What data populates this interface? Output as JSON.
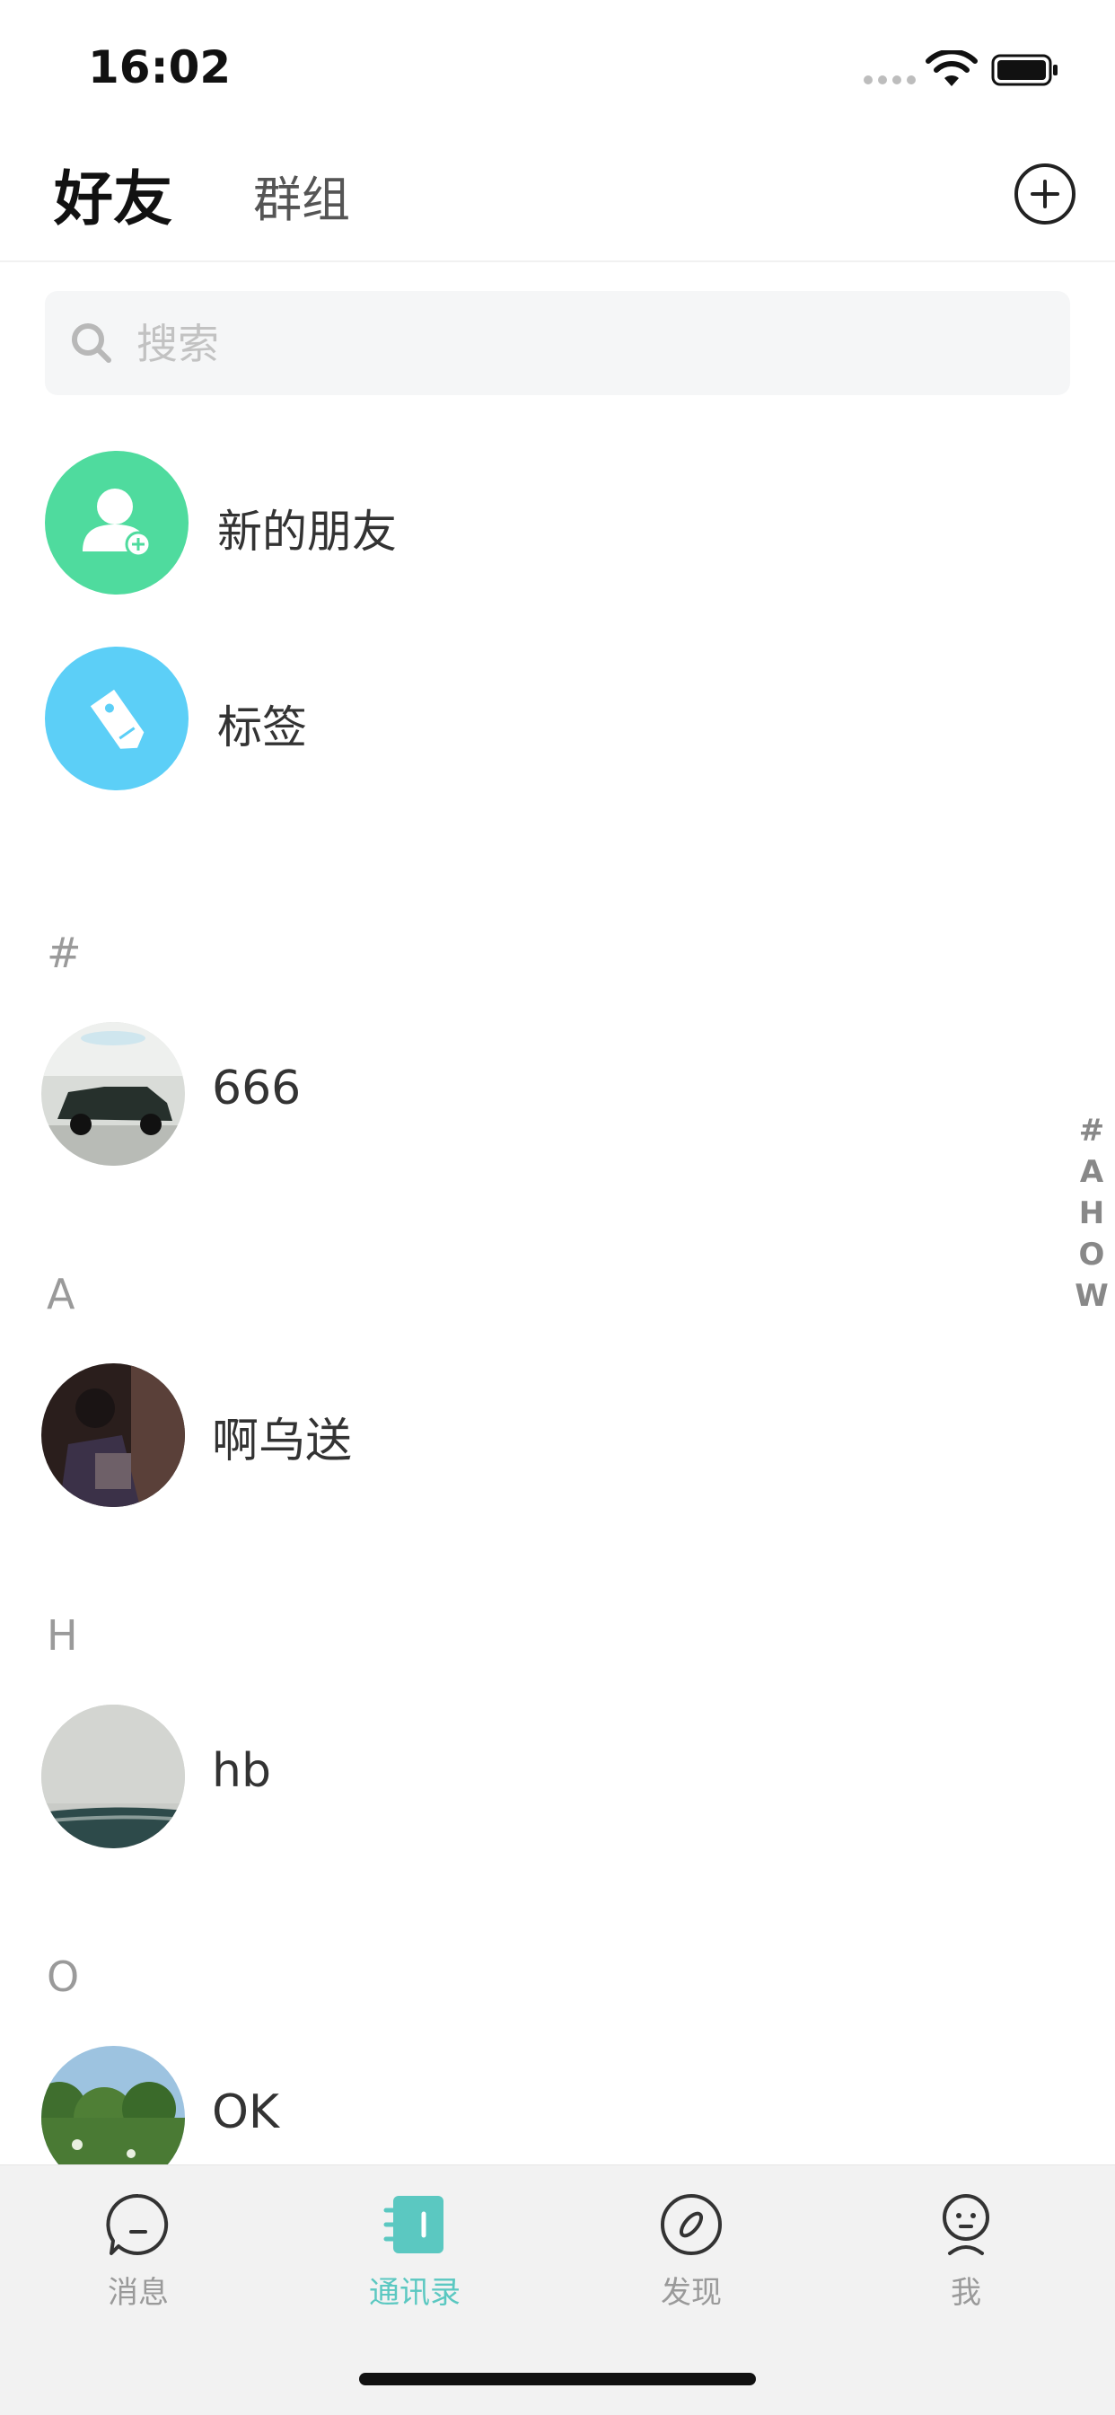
{
  "status_bar": {
    "time": "16:02"
  },
  "header": {
    "tab_friends": "好友",
    "tab_groups": "群组"
  },
  "search": {
    "placeholder": "搜索"
  },
  "quick_rows": [
    {
      "label": "新的朋友",
      "icon": "add-person-icon",
      "color": "#4fdb9e"
    },
    {
      "label": "标签",
      "icon": "tag-icon",
      "color": "#5ccff7"
    }
  ],
  "sections": [
    {
      "letter": "#",
      "contacts": [
        {
          "name": "666"
        }
      ]
    },
    {
      "letter": "A",
      "contacts": [
        {
          "name": "啊乌送"
        }
      ]
    },
    {
      "letter": "H",
      "contacts": [
        {
          "name": "hb"
        }
      ]
    },
    {
      "letter": "O",
      "contacts": [
        {
          "name": "OK"
        }
      ]
    }
  ],
  "index_bar": [
    "#",
    "A",
    "H",
    "O",
    "W"
  ],
  "tab_bar": {
    "accent": "#5bc8c1",
    "items": [
      {
        "label": "消息",
        "icon": "message-icon"
      },
      {
        "label": "通讯录",
        "icon": "contacts-icon",
        "active": true
      },
      {
        "label": "发现",
        "icon": "compass-icon"
      },
      {
        "label": "我",
        "icon": "profile-icon"
      }
    ]
  }
}
